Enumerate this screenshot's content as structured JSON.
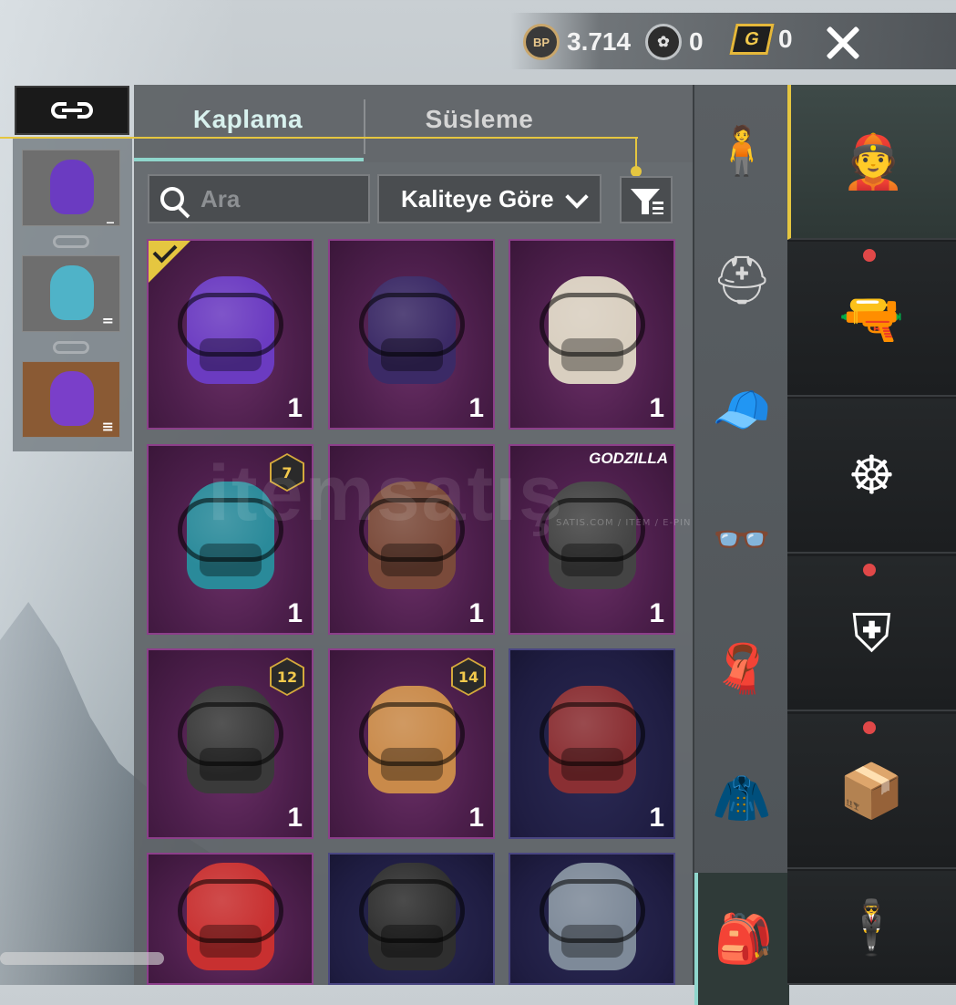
{
  "currencies": [
    {
      "icon": "bp-coin-icon",
      "label": "BP",
      "value": "3.714"
    },
    {
      "icon": "ag-coin-icon",
      "label": "",
      "value": "0"
    },
    {
      "icon": "g-coin-icon",
      "label": "G",
      "value": "0"
    }
  ],
  "tabs": [
    {
      "label": "Kaplama",
      "active": true
    },
    {
      "label": "Süsleme",
      "active": false
    }
  ],
  "search": {
    "placeholder": "Ara"
  },
  "sort": {
    "selected": "Kaliteye Göre"
  },
  "presets": [
    {
      "name": "jester-backpack",
      "qty": "_"
    },
    {
      "name": "jester-backpack-teal",
      "qty": "="
    },
    {
      "name": "jester-backpack-purple",
      "qty": "≡",
      "active": true
    }
  ],
  "items": [
    {
      "name": "jester-backpack",
      "qty": "1",
      "equipped": true,
      "color": "#6b3bc1"
    },
    {
      "name": "purple-lux-backpack",
      "qty": "1",
      "color": "#3b2a66"
    },
    {
      "name": "lucky-cat-backpack",
      "qty": "1",
      "color": "#d9cfc0"
    },
    {
      "name": "scifi-teal-backpack",
      "qty": "1",
      "level": "7",
      "color": "#2a8a9a"
    },
    {
      "name": "patchwork-backpack",
      "qty": "1",
      "color": "#7a4a3a"
    },
    {
      "name": "godzilla-backpack",
      "qty": "1",
      "brand": "GODZILLA",
      "color": "#444444"
    },
    {
      "name": "gothic-doll-backpack",
      "qty": "1",
      "level": "12",
      "color": "#3a3a3a"
    },
    {
      "name": "corgi-backpack",
      "qty": "1",
      "level": "14",
      "color": "#c98a4a"
    },
    {
      "name": "festive-sweater-backpack",
      "qty": "1",
      "dark": true,
      "color": "#8a2f33"
    },
    {
      "name": "red-club-backpack",
      "qty": "",
      "color": "#c83030"
    },
    {
      "name": "tactical-black-backpack",
      "qty": "",
      "dark": true,
      "color": "#2f2f2f"
    },
    {
      "name": "steel-armored-backpack",
      "qty": "",
      "dark": true,
      "color": "#7e8a99"
    }
  ],
  "categories_rail1": [
    {
      "name": "outfit-figure-icon",
      "glyph": "🧍"
    },
    {
      "name": "helmet-icon",
      "glyph": "⛑"
    },
    {
      "name": "cap-icon",
      "glyph": "🧢"
    },
    {
      "name": "glasses-icon",
      "glyph": "👓"
    },
    {
      "name": "bandana-icon",
      "glyph": "🧣"
    },
    {
      "name": "jacket-icon",
      "glyph": "🧥"
    },
    {
      "name": "backpack-icon",
      "glyph": "🎒",
      "active": true
    }
  ],
  "categories_rail2": [
    {
      "name": "character-icon",
      "glyph": "👲",
      "active": true
    },
    {
      "name": "pistol-icon",
      "glyph": "🔫",
      "dot": true
    },
    {
      "name": "steering-wheel-icon",
      "glyph": "☸"
    },
    {
      "name": "shield-icon",
      "glyph": "⛨",
      "dot": true
    },
    {
      "name": "crate-icon",
      "glyph": "📦",
      "dot": true
    },
    {
      "name": "agent-icon",
      "glyph": "🕴"
    }
  ],
  "watermark": {
    "text": "itemsatış",
    "sub": "SATIS.COM / ITEM / E-PIN • COM"
  }
}
